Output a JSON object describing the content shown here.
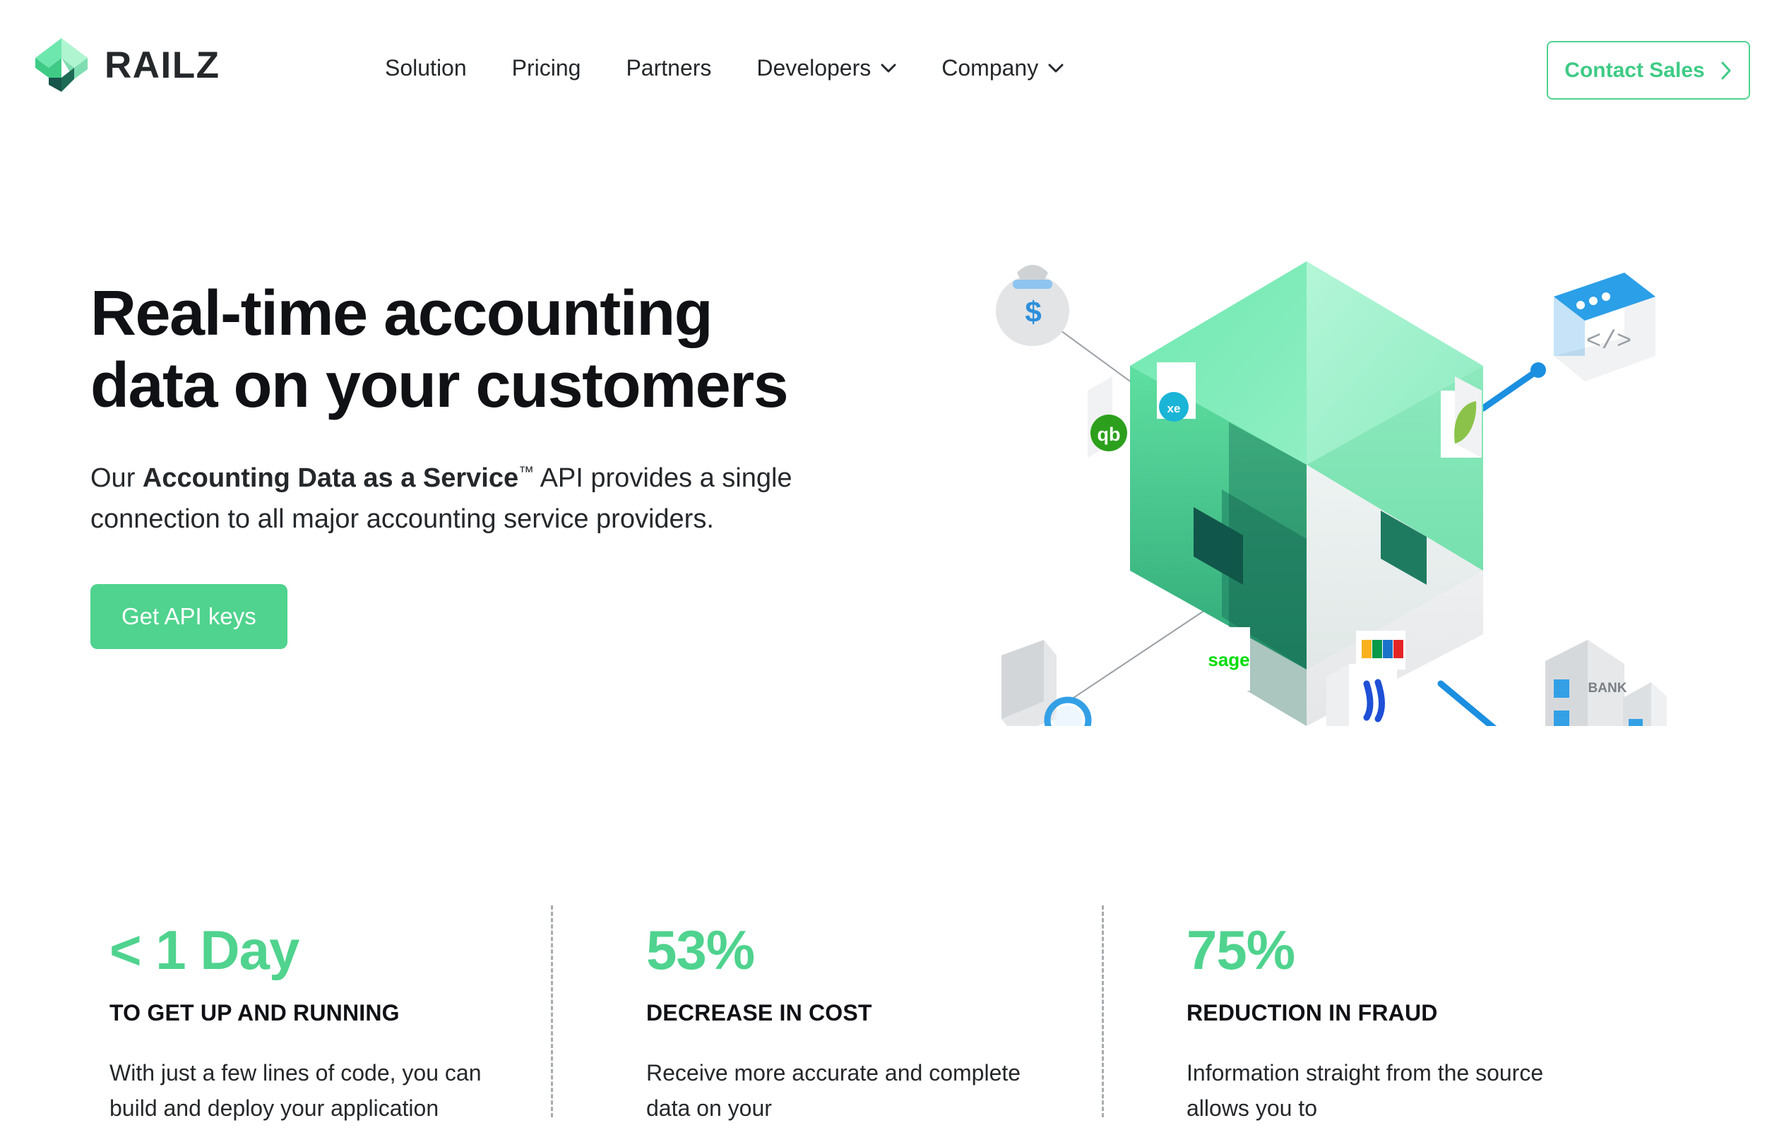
{
  "brand": {
    "name": "RAILZ",
    "logo_icon": "railz-cube-logo",
    "colors": {
      "accent": "#4FD38E",
      "accent_dark": "#17544A",
      "accent_light": "#A9F3CE",
      "text": "#25282B"
    }
  },
  "nav": {
    "items": [
      {
        "label": "Solution",
        "has_dropdown": false
      },
      {
        "label": "Pricing",
        "has_dropdown": false
      },
      {
        "label": "Partners",
        "has_dropdown": false
      },
      {
        "label": "Developers",
        "has_dropdown": true,
        "icon": "chevron-down-icon"
      },
      {
        "label": "Company",
        "has_dropdown": true,
        "icon": "chevron-down-icon"
      }
    ],
    "cta": {
      "label": "Contact Sales",
      "icon": "chevron-right-icon"
    }
  },
  "hero": {
    "headline_line1": "Real-time accounting",
    "headline_line2": "data on your customers",
    "sub_prefix": "Our ",
    "sub_bold": "Accounting Data as a Service",
    "sub_tm": "™",
    "sub_suffix": " API provides a single connection to all major accounting service providers.",
    "cta_label": "Get API keys",
    "illustration": {
      "name": "isometric-data-cube-illustration",
      "center_object": "green-isometric-cube",
      "tiles": [
        {
          "name": "quickbooks-tile",
          "label": "qb"
        },
        {
          "name": "xero-tile",
          "label": "xero"
        },
        {
          "name": "freshbooks-leaf-tile",
          "label": "leaf"
        },
        {
          "name": "sage-tile",
          "label": "sage"
        },
        {
          "name": "zoho-tile",
          "label": "zoho"
        },
        {
          "name": "wave-tile",
          "label": "wave"
        }
      ],
      "nodes": [
        {
          "name": "money-bag-icon",
          "label": "$"
        },
        {
          "name": "ledger-book-magnifier-icon",
          "label": ""
        },
        {
          "name": "code-window-icon",
          "label": "</>"
        },
        {
          "name": "bank-building-icon",
          "label": "BANK"
        }
      ]
    }
  },
  "stats": [
    {
      "value": "< 1 Day",
      "title": "TO GET UP AND RUNNING",
      "desc": "With just a few lines of code, you can build and deploy your application"
    },
    {
      "value": "53%",
      "title": "DECREASE IN COST",
      "desc": "Receive more accurate and complete data on your"
    },
    {
      "value": "75%",
      "title": "REDUCTION IN FRAUD",
      "desc": "Information straight from the source allows you to"
    }
  ]
}
